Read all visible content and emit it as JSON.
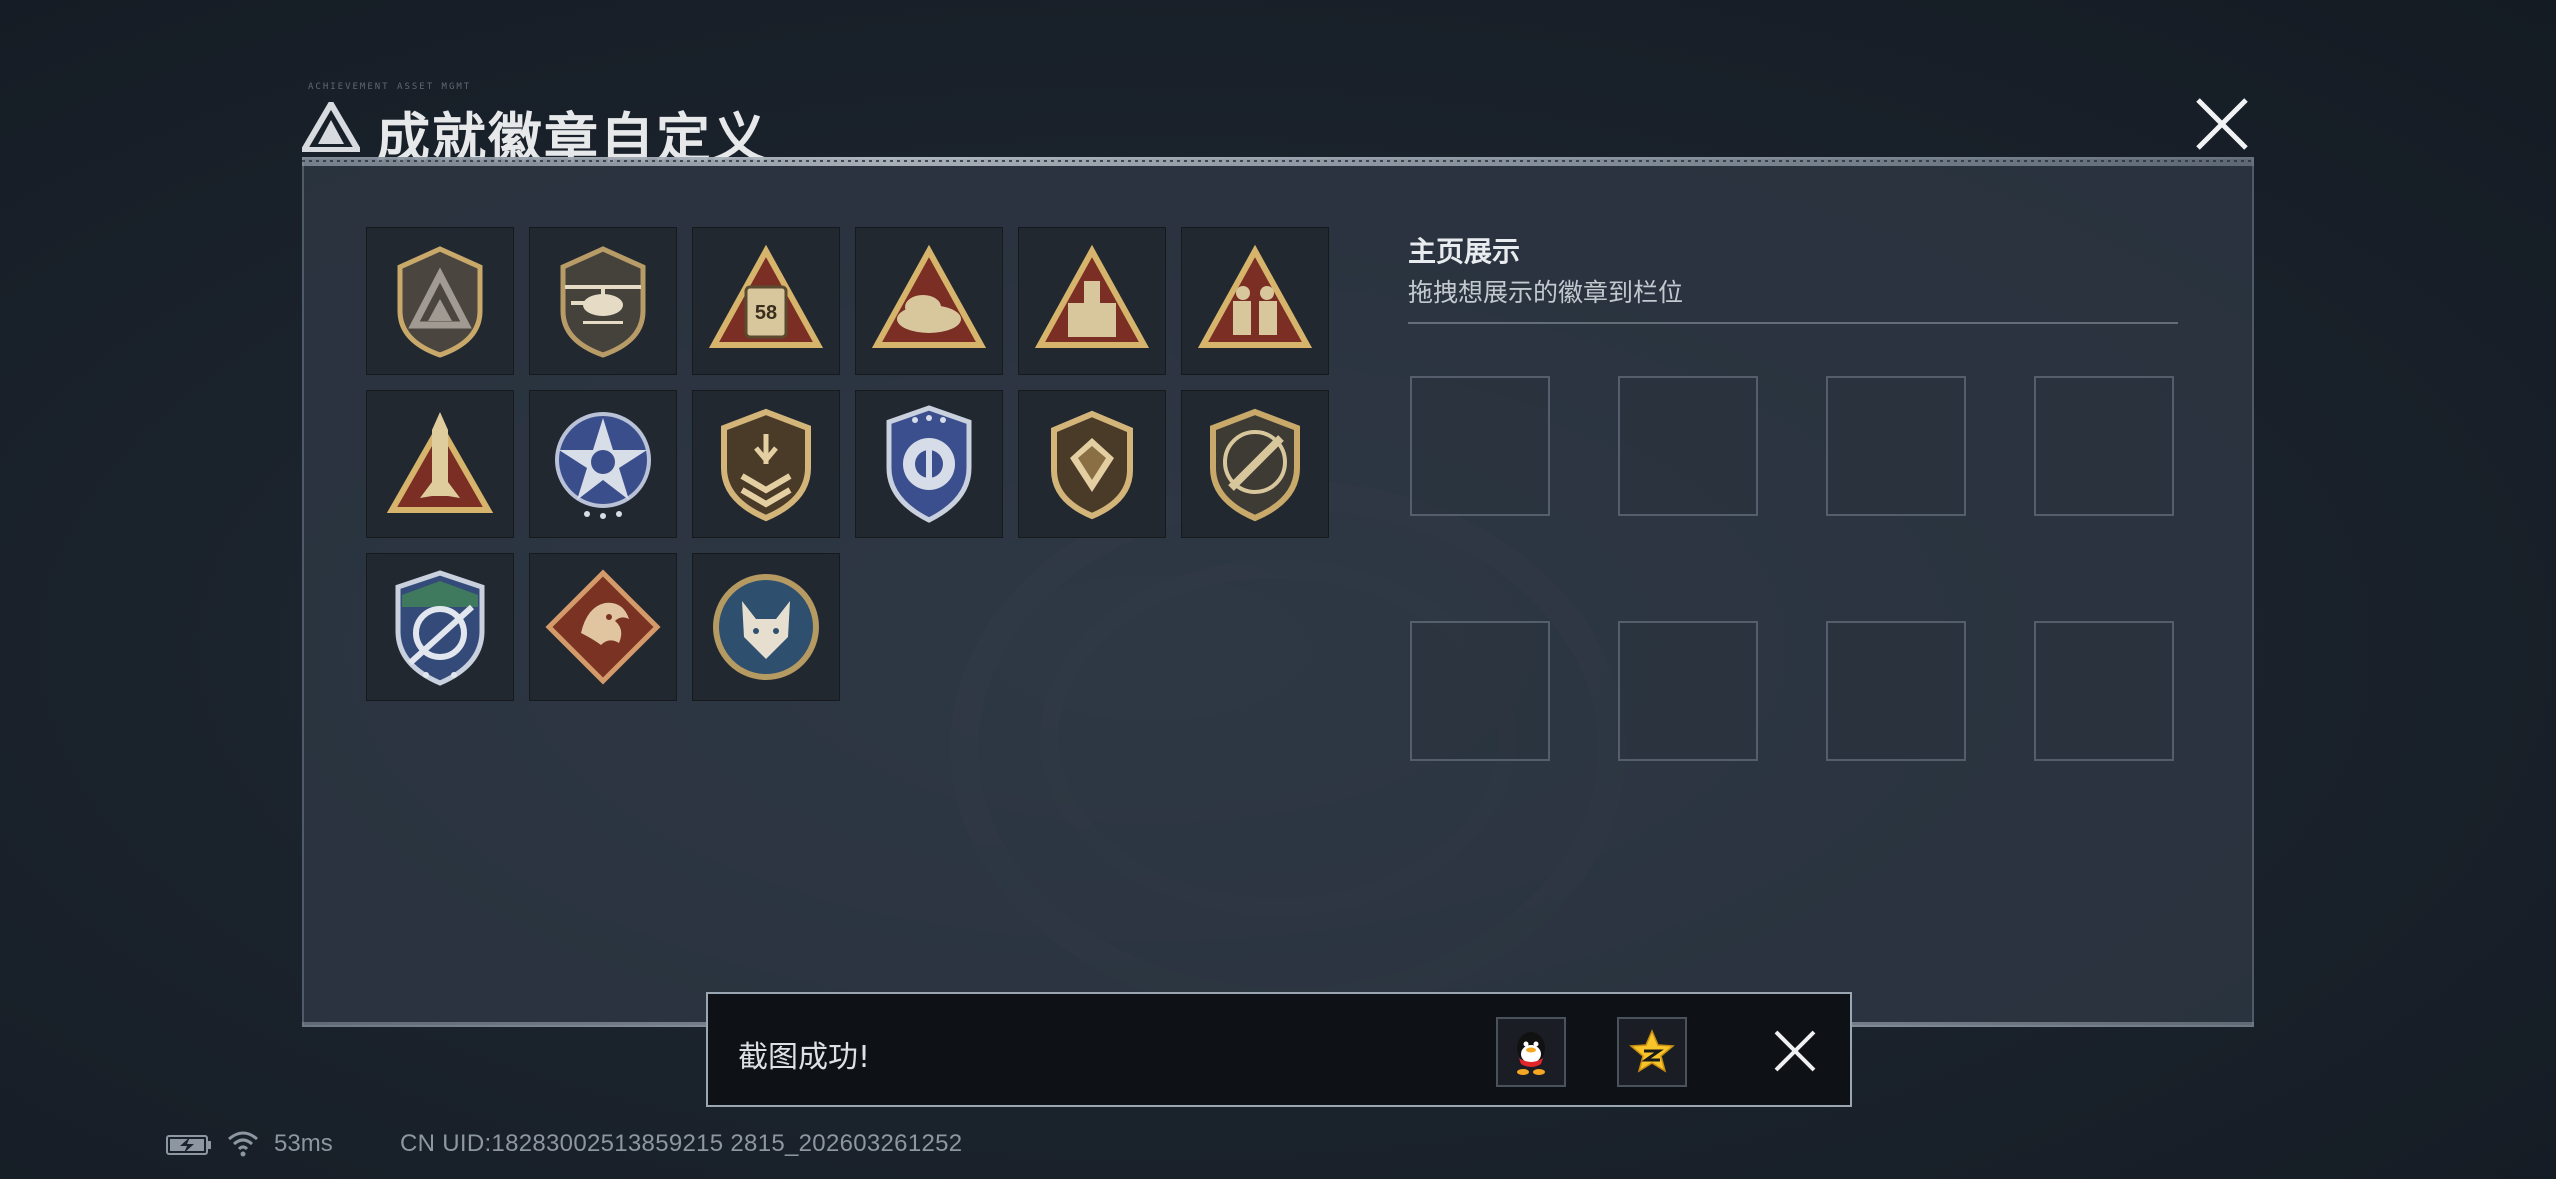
{
  "header": {
    "title": "成就徽章自定义",
    "deco_text": "ACHIEVEMENT ASSET MGMT"
  },
  "badges": [
    {
      "name": "triangle-shield-badge",
      "icon": "triangle-in-shield"
    },
    {
      "name": "helicopter-badge",
      "icon": "helicopter"
    },
    {
      "name": "radio-58-badge",
      "icon": "radio",
      "label": "58"
    },
    {
      "name": "beret-badge",
      "icon": "beret"
    },
    {
      "name": "crate-badge",
      "icon": "supply-crate"
    },
    {
      "name": "soldiers-badge",
      "icon": "soldiers"
    },
    {
      "name": "rocket-badge",
      "icon": "rocket"
    },
    {
      "name": "star-wreath-badge",
      "icon": "star-emblem"
    },
    {
      "name": "rank-shield-badge",
      "icon": "rank-chevrons"
    },
    {
      "name": "blue-shield-badge",
      "icon": "blue-shield"
    },
    {
      "name": "gem-shield-badge",
      "icon": "diamond-gem"
    },
    {
      "name": "rifle-badge",
      "icon": "rifle"
    },
    {
      "name": "crosshair-badge",
      "icon": "crosshair-arrows"
    },
    {
      "name": "dragon-badge",
      "icon": "dragon"
    },
    {
      "name": "wolf-badge",
      "icon": "wolf"
    }
  ],
  "showcase": {
    "title": "主页展示",
    "subtitle": "拖拽想展示的徽章到栏位",
    "slot_count": 8
  },
  "toast": {
    "message": "截图成功!",
    "share_icons": [
      "qq-icon",
      "qzone-icon"
    ]
  },
  "status": {
    "ping": "53ms",
    "uid": "CN UID:18283002513859215 2815_202603261252"
  },
  "colors": {
    "gold": "#c8a96a",
    "panel": "#303a46",
    "accent_blue": "#3a4e8c"
  }
}
